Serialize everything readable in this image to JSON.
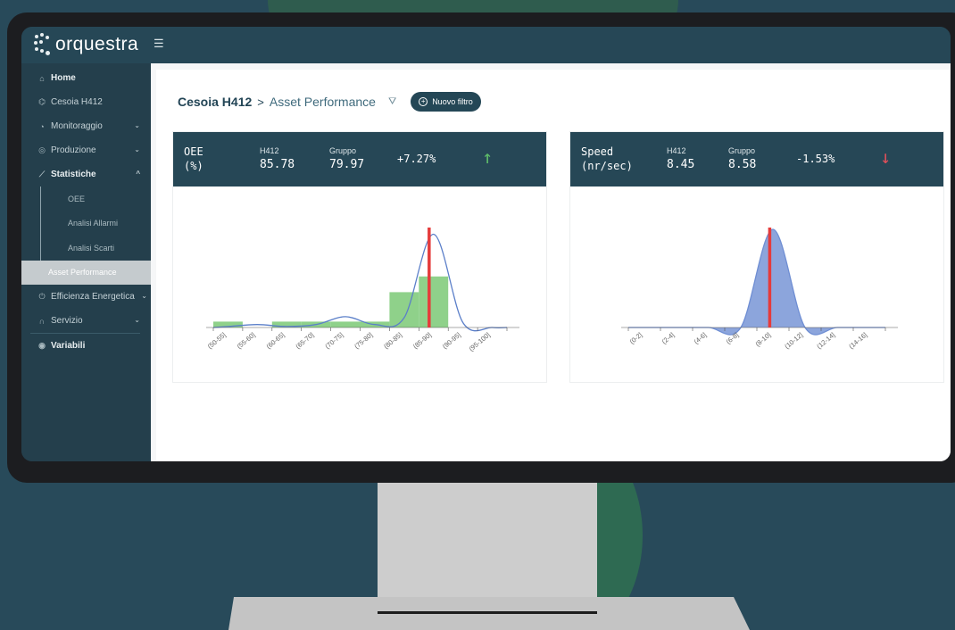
{
  "app": {
    "logo_text": "orquestra",
    "menu_icon": "menu-collapse-icon"
  },
  "sidebar": {
    "items": [
      {
        "label": "Home",
        "icon": "home-icon",
        "bold": true
      },
      {
        "label": "Cesoia H412",
        "icon": "machine-icon"
      },
      {
        "label": "Monitoraggio",
        "icon": "gauge-icon",
        "chevron": "down"
      },
      {
        "label": "Produzione",
        "icon": "coin-icon",
        "chevron": "down"
      },
      {
        "label": "Statistiche",
        "icon": "chart-line-icon",
        "chevron": "up",
        "bold": true
      }
    ],
    "sub_items": [
      {
        "label": "OEE"
      },
      {
        "label": "Analisi Allarmi"
      },
      {
        "label": "Analisi Scarti"
      },
      {
        "label": "Asset Performance",
        "active": true
      }
    ],
    "items_after": [
      {
        "label": "Efficienza Energetica",
        "icon": "power-icon",
        "chevron": "down"
      },
      {
        "label": "Servizio",
        "icon": "headset-icon",
        "chevron": "down"
      },
      {
        "label": "Variabili",
        "icon": "eye-icon",
        "bold": true
      }
    ]
  },
  "breadcrumb": {
    "parent": "Cesoia H412",
    "separator": ">",
    "current": "Asset Performance"
  },
  "filter": {
    "label": "Nuovo filtro"
  },
  "cards": [
    {
      "title_line1": "OEE",
      "title_line2": "(%)",
      "h412_label": "H412",
      "h412_value": "85.78",
      "gruppo_label": "Gruppo",
      "gruppo_value": "79.97",
      "delta": "+7.27%",
      "trend": "up",
      "trend_color": "#5fbf6a"
    },
    {
      "title_line1": "Speed",
      "title_line2": "(nr/sec)",
      "h412_label": "H412",
      "h412_value": "8.45",
      "gruppo_label": "Gruppo",
      "gruppo_value": "8.58",
      "delta": "-1.53%",
      "trend": "down",
      "trend_color": "#e0505a"
    }
  ],
  "chart_data": [
    {
      "type": "bar",
      "categories": [
        "(50-55]",
        "(55-60]",
        "(60-65]",
        "(65-70]",
        "(70-75]",
        "(75-80]",
        "(80-85]",
        "(85-90]",
        "(90-95]",
        "(95-100]"
      ],
      "values": [
        6,
        0,
        6,
        6,
        6,
        6,
        36,
        52,
        0,
        0
      ],
      "series": [
        {
          "kind": "bar",
          "color": "#8fd18a",
          "values": [
            6,
            0,
            6,
            6,
            6,
            6,
            36,
            52,
            0,
            0
          ]
        },
        {
          "kind": "density",
          "color": "#5b7fc9",
          "values": [
            1,
            3,
            1,
            3,
            11,
            3,
            10,
            95,
            5,
            0
          ]
        }
      ],
      "marker": {
        "category_index": 7,
        "fraction": 0.35,
        "color": "#e53b3b"
      },
      "ylim": [
        0,
        100
      ]
    },
    {
      "type": "area",
      "categories": [
        "(0-2]",
        "(2-4]",
        "(4-6]",
        "(6-8]",
        "(8-10]",
        "(10-12]",
        "(12-14]",
        "(14-16]"
      ],
      "series": [
        {
          "kind": "density",
          "color": "#6f8ed3",
          "fill": "#7f9bd8",
          "values": [
            0,
            0,
            0,
            0,
            100,
            0,
            0,
            0
          ]
        }
      ],
      "marker": {
        "category_index": 4,
        "fraction": 0.4,
        "color": "#e53b3b"
      },
      "ylim": [
        0,
        100
      ]
    }
  ]
}
